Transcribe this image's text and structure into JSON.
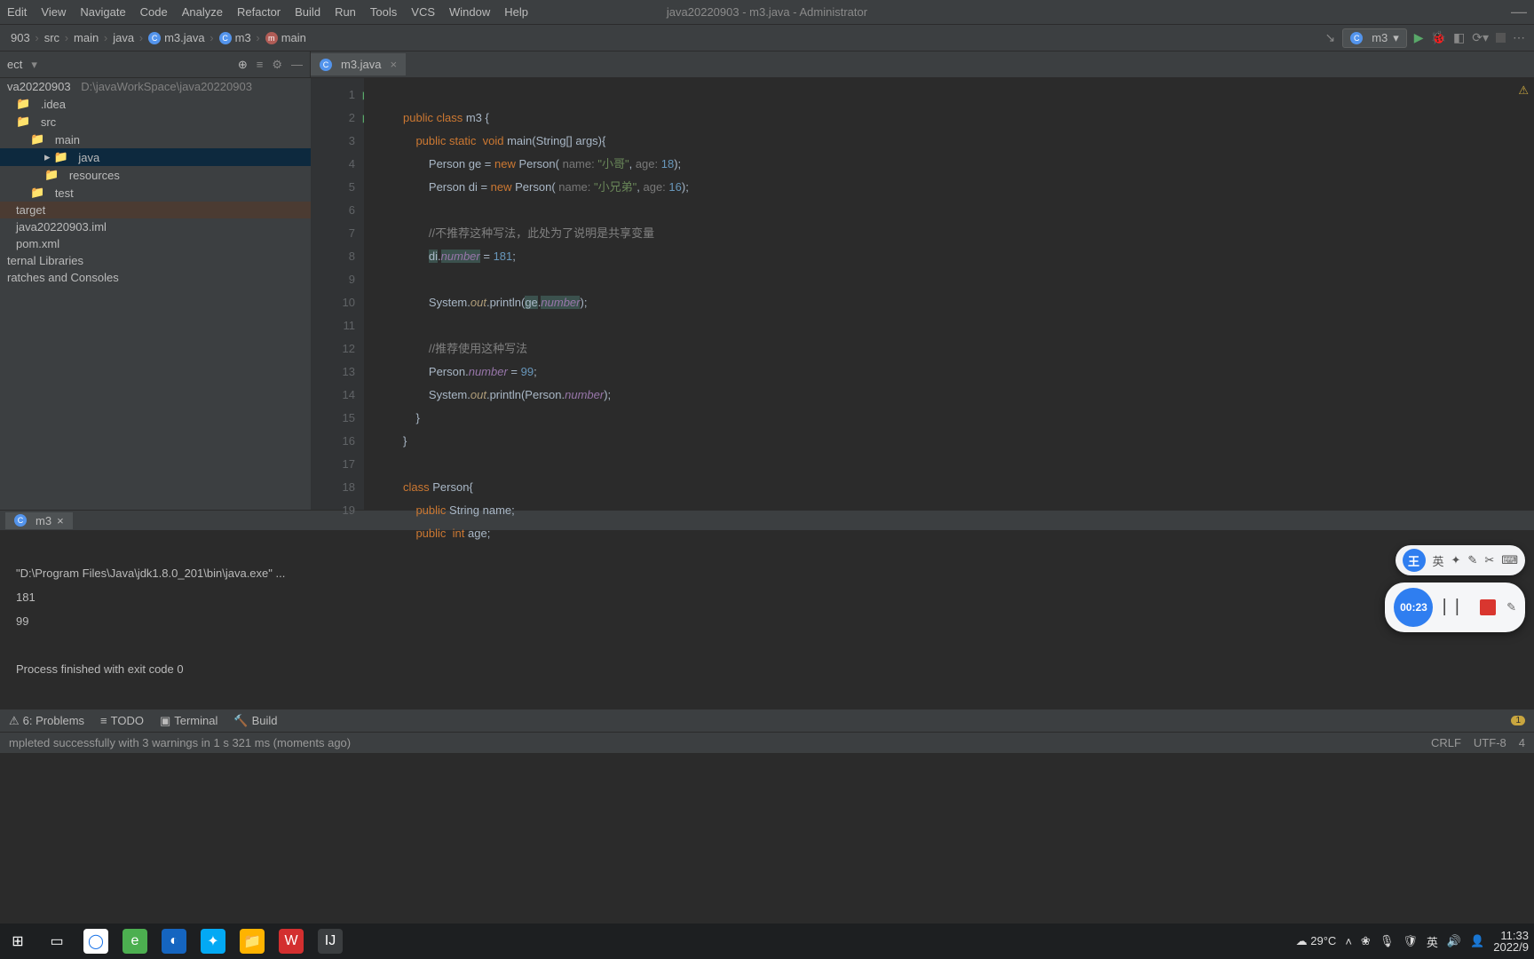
{
  "window": {
    "title": "java20220903 - m3.java - Administrator"
  },
  "menu": {
    "edit": "Edit",
    "view": "View",
    "navigate": "Navigate",
    "code": "Code",
    "analyze": "Analyze",
    "refactor": "Refactor",
    "build": "Build",
    "run": "Run",
    "tools": "Tools",
    "vcs": "VCS",
    "window": "Window",
    "help": "Help"
  },
  "breadcrumbs": {
    "p0": "903",
    "p1": "src",
    "p2": "main",
    "p3": "java",
    "p4": "m3.java",
    "p5": "m3",
    "p6": "main"
  },
  "runcfg": {
    "name": "m3"
  },
  "project_header": {
    "label": "ect"
  },
  "tree": {
    "root_name": "va20220903",
    "root_path": "D:\\javaWorkSpace\\java20220903",
    "idea": ".idea",
    "src": "src",
    "main": "main",
    "java": "java",
    "resources": "resources",
    "test": "test",
    "target": "target",
    "iml": "java20220903.iml",
    "pom": "pom.xml",
    "ext": "ternal Libraries",
    "scratch": "ratches and Consoles"
  },
  "editor_tab": {
    "name": "m3.java"
  },
  "gutter": {
    "lines": [
      "1",
      "2",
      "3",
      "4",
      "5",
      "6",
      "7",
      "8",
      "9",
      "10",
      "11",
      "12",
      "13",
      "14",
      "15",
      "16",
      "17",
      "18",
      "19"
    ]
  },
  "code": {
    "l1a": "public class ",
    "l1b": "m3 {",
    "l2a": "public static  ",
    "l2b": "void ",
    "l2c": "main",
    "l2d": "(String[] args){",
    "l3a": "Person ge = ",
    "l3b": "new ",
    "l3c": "Person( ",
    "l3h1": "name: ",
    "l3s": "\"小哥\"",
    "l3h2": ", ",
    "l3h3": "age: ",
    "l3n": "18",
    "l3e": ");",
    "l4a": "Person di = ",
    "l4b": "new ",
    "l4c": "Person( ",
    "l4h1": "name: ",
    "l4s": "\"小兄弟\"",
    "l4h2": ", ",
    "l4h3": "age: ",
    "l4n": "16",
    "l4e": ");",
    "l6": "//不推荐这种写法，此处为了说明是共享变量",
    "l7a": "di",
    "l7b": ".",
    "l7c": "number",
    "l7d": " = ",
    "l7n": "181",
    "l7e": ";",
    "l9a": "System.",
    "l9b": "out",
    "l9c": ".println(",
    "l9d": "ge",
    "l9e": ".",
    "l9f": "number",
    "l9g": ");",
    "l11": "//推荐使用这种写法",
    "l12a": "Person.",
    "l12b": "number",
    "l12c": " = ",
    "l12n": "99",
    "l12d": ";",
    "l13a": "System.",
    "l13b": "out",
    "l13c": ".println(Person.",
    "l13d": "number",
    "l13e": ");",
    "l14": "}",
    "l15": "}",
    "l17a": "class ",
    "l17b": "Person{",
    "l18a": "public ",
    "l18b": "String name;",
    "l19a": "public  ",
    "l19b": "int ",
    "l19c": "age;"
  },
  "run_tab": {
    "name": "m3"
  },
  "console": {
    "l1": "\"D:\\Program Files\\Java\\jdk1.8.0_201\\bin\\java.exe\" ...",
    "l2": "181",
    "l3": "99",
    "l4": "",
    "l5": "Process finished with exit code 0"
  },
  "bottom": {
    "problems": "6: Problems",
    "todo": "TODO",
    "terminal": "Terminal",
    "build": "Build",
    "badge": "1"
  },
  "status": {
    "msg": "mpleted successfully with 3 warnings in 1 s 321 ms (moments ago)",
    "crlf": "CRLF",
    "enc": "UTF-8",
    "col": "4"
  },
  "ime": {
    "lang": "英"
  },
  "recorder": {
    "time": "00:23"
  },
  "tray": {
    "weather": "29°C",
    "ime": "英",
    "time": "11:33",
    "date": "2022/9"
  }
}
